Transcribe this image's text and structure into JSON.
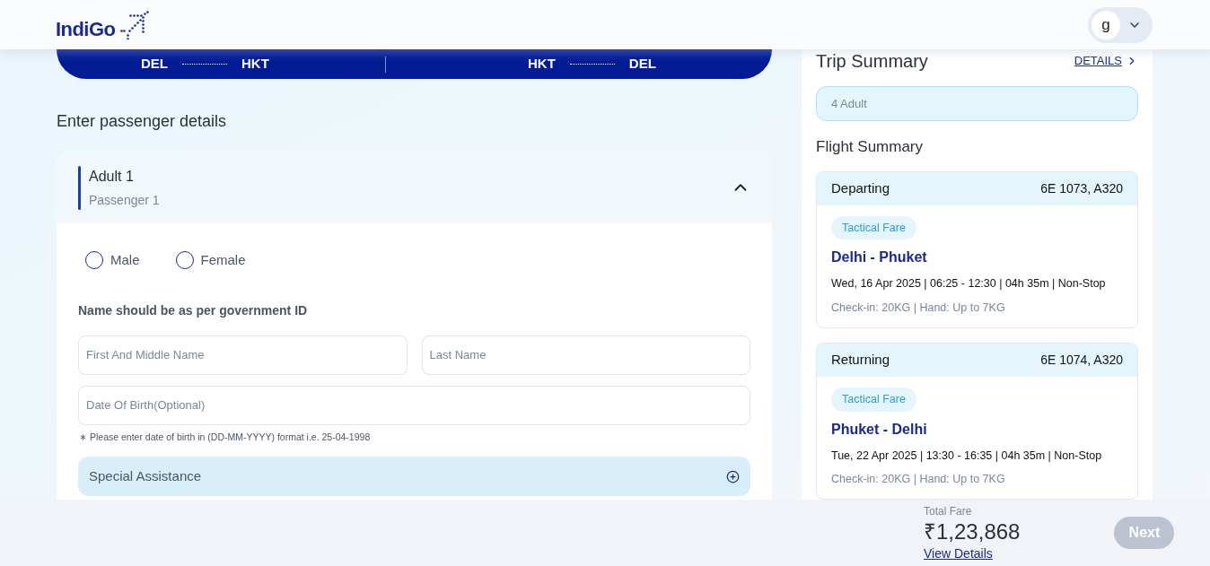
{
  "header": {
    "logo": "IndiGo",
    "user_initial": "g"
  },
  "route_bar": {
    "legs": [
      {
        "from": "DEL",
        "to": "HKT"
      },
      {
        "from": "HKT",
        "to": "DEL"
      }
    ]
  },
  "section_title": "Enter passenger details",
  "passenger": {
    "title": "Adult 1",
    "subtitle": "Passenger 1",
    "expanded": true,
    "genders": [
      {
        "label": "Male",
        "selected": false
      },
      {
        "label": "Female",
        "selected": false
      }
    ],
    "name_note": "Name should be as per government ID",
    "fields": [
      {
        "placeholder": "First And Middle Name"
      },
      {
        "placeholder": "Last Name"
      }
    ],
    "dob": {
      "placeholder": "Date Of Birth(Optional)"
    },
    "dob_hint": "Please enter date of birth in (DD-MM-YYYY) format i.e. 25-04-1998",
    "special_assistance": {
      "label": "Special Assistance",
      "expanded": false
    }
  },
  "trip_summary": {
    "title": "Trip Summary",
    "details_link": "DETAILS",
    "travellers": "4 Adult",
    "flight_summary_title": "Flight Summary",
    "flights": [
      {
        "direction": "Departing",
        "flight_no": "6E 1073, A320",
        "fare": "Tactical Fare",
        "route": "Delhi - Phuket",
        "schedule": "Wed, 16 Apr 2025 | 06:25 - 12:30 | 04h 35m | Non-Stop",
        "baggage": "Check-in: 20KG | Hand: Up to 7KG"
      },
      {
        "direction": "Returning",
        "flight_no": "6E 1074, A320",
        "fare": "Tactical Fare",
        "route": "Phuket - Delhi",
        "schedule": "Tue, 22 Apr 2025 | 13:30 - 16:35 | 04h 35m | Non-Stop",
        "baggage": "Check-in: 20KG | Hand: Up to 7KG"
      }
    ]
  },
  "footer": {
    "total_label": "Total Fare",
    "total": "₹1,23,868",
    "view_details": "View Details",
    "next": {
      "label": "Next",
      "disabled": true
    }
  }
}
